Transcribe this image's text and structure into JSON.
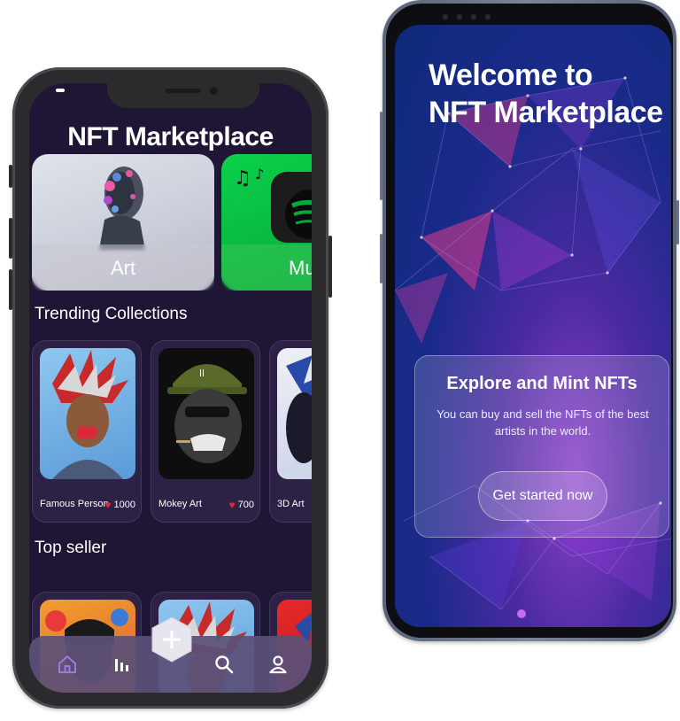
{
  "left_app": {
    "title": "NFT Marketplace",
    "categories": [
      {
        "label": "Art"
      },
      {
        "label": "Mu"
      }
    ],
    "trending_title": "Trending Collections",
    "collections": [
      {
        "name": "Famous Person",
        "likes": "1000"
      },
      {
        "name": "Mokey Art",
        "likes": "700"
      },
      {
        "name": "3D Art",
        "likes": ""
      }
    ],
    "top_seller_title": "Top seller",
    "nav": {
      "home_icon": "home-icon",
      "stats_icon": "bar-chart-icon",
      "add_icon": "plus-icon",
      "search_icon": "search-icon",
      "profile_icon": "user-icon"
    }
  },
  "right_app": {
    "welcome_line1": "Welcome to",
    "welcome_line2": "NFT Marketplace",
    "card_heading": "Explore and Mint NFTs",
    "card_description": "You can buy and sell the NFTs of the best artists in the world.",
    "cta_label": "Get started now"
  },
  "colors": {
    "left_background": "#1f1534",
    "heart": "#e3273d",
    "nav_active": "#9b7be0",
    "page_dot": "#c46bf0"
  }
}
